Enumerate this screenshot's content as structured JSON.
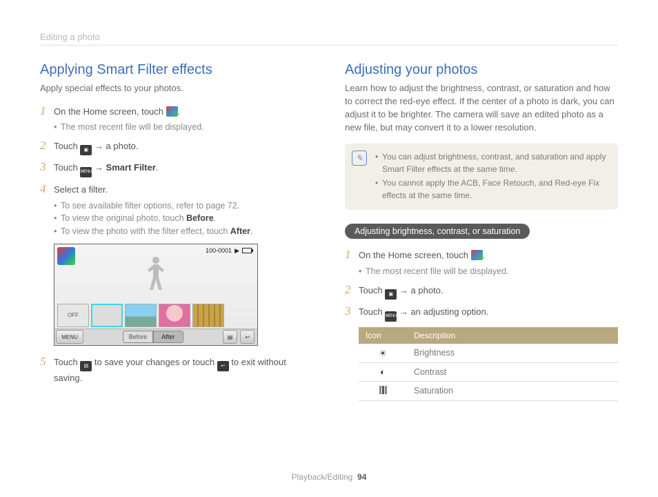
{
  "breadcrumb": "Editing a photo",
  "footer_section": "Playback/Editing",
  "page_number": "94",
  "left": {
    "heading": "Applying Smart Filter effects",
    "intro": "Apply special effects to your photos.",
    "step1_a": "On the Home screen, touch ",
    "step1_b": ".",
    "step1_sub1": "The most recent file will be displayed.",
    "step2_a": "Touch ",
    "step2_b": " → a photo.",
    "step3_a": "Touch ",
    "step3_b": " → ",
    "step3_bold": "Smart Filter",
    "step3_c": ".",
    "step4": "Select a filter.",
    "step4_sub1": "To see available filter options, refer to page 72.",
    "step4_sub2_a": "To view the original photo, touch ",
    "step4_sub2_bold": "Before",
    "step4_sub2_b": ".",
    "step4_sub3_a": "To view the photo with the filter effect, touch ",
    "step4_sub3_bold": "After",
    "step4_sub3_b": ".",
    "step5_a": "Touch ",
    "step5_b": " to save your changes or touch ",
    "step5_c": " to exit without saving.",
    "ss": {
      "counter": "100-0001",
      "off": "OFF",
      "menu": "MENU",
      "before": "Before",
      "after": "After"
    }
  },
  "right": {
    "heading": "Adjusting your photos",
    "intro": "Learn how to adjust the brightness, contrast, or saturation and how to correct the red-eye effect. If the center of a photo is dark, you can adjust it to be brighter. The camera will save an edited photo as a new file, but may convert it to a lower resolution.",
    "note1": "You can adjust brightness, contrast, and saturation and apply Smart Filter effects at the same time.",
    "note2": "You cannot apply the ACB, Face Retouch, and Red-eye Fix effects at the same time.",
    "pill": "Adjusting brightness, contrast, or saturation",
    "step1_a": "On the Home screen, touch ",
    "step1_b": ".",
    "step1_sub1": "The most recent file will be displayed.",
    "step2_a": "Touch ",
    "step2_b": " → a photo.",
    "step3_a": "Touch ",
    "step3_b": " → an adjusting option.",
    "th_icon": "Icon",
    "th_desc": "Description",
    "row1": "Brightness",
    "row2": "Contrast",
    "row3": "Saturation"
  }
}
